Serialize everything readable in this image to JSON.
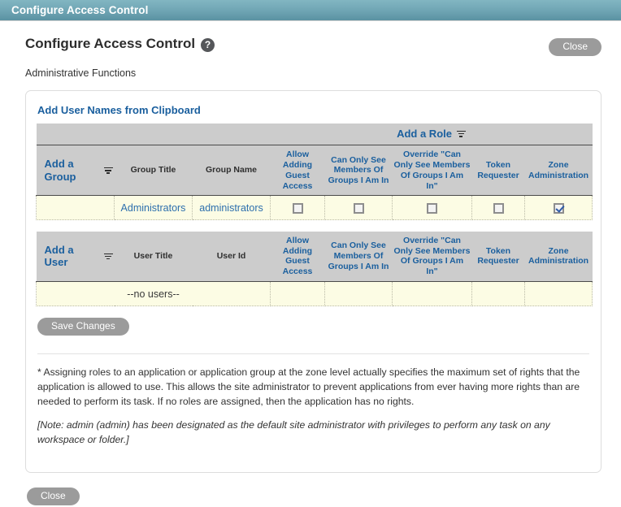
{
  "window": {
    "title": "Configure Access Control"
  },
  "header": {
    "title": "Configure Access Control",
    "help_icon": "question-mark-icon",
    "close_label": "Close",
    "subtitle": "Administrative Functions"
  },
  "panel": {
    "clipboard_link": "Add User Names from Clipboard",
    "role_header": "Add a Role",
    "role_columns": [
      "Allow Adding Guest Access",
      "Can Only See Members Of Groups I Am In",
      "Override \"Can Only See Members Of Groups I Am In\"",
      "Token Requester",
      "Zone Administration"
    ],
    "group_section": {
      "add_label": "Add a Group",
      "col_title": "Group Title",
      "col_name": "Group Name",
      "rows": [
        {
          "title": "Administrators",
          "name": "administrators",
          "checks": [
            false,
            false,
            false,
            false,
            true
          ]
        }
      ]
    },
    "user_section": {
      "add_label": "Add a User",
      "col_title": "User Title",
      "col_name": "User Id",
      "empty_text": "--no users--",
      "rows": []
    },
    "save_label": "Save Changes"
  },
  "notes": {
    "note1": "* Assigning roles to an application or application group at the zone level actually specifies the maximum set of rights that the application is allowed to use. This allows the site administrator to prevent applications from ever having more rights than are needed to perform its task. If no roles are assigned, then the application has no rights.",
    "note2": "[Note: admin (admin) has been designated as the default site administrator with privileges to perform any task on any workspace or folder.]"
  },
  "footer": {
    "close_label": "Close"
  },
  "colors": {
    "titlebar_light": "#82b6c2",
    "titlebar_dark": "#5a92a2",
    "link": "#1a5f9e",
    "header_bg": "#cccccc",
    "row_bg": "#fcfce4",
    "button_bg": "#9b9b9b",
    "check_color": "#2f5ca8"
  }
}
